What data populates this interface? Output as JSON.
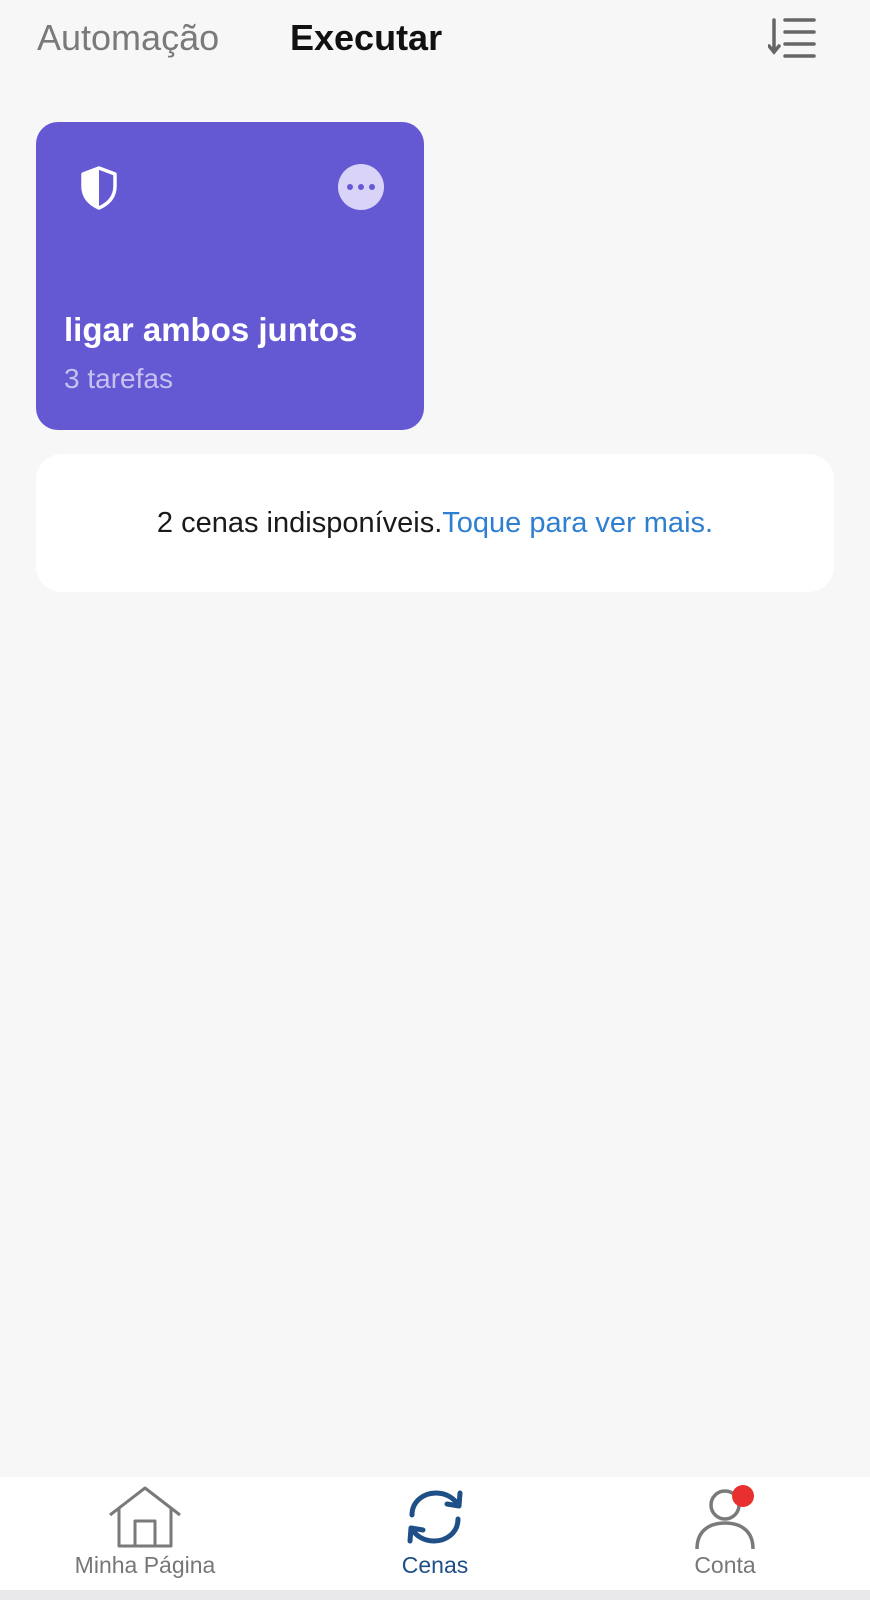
{
  "header": {
    "tabs": [
      {
        "label": "Automação",
        "active": false
      },
      {
        "label": "Executar",
        "active": true
      }
    ],
    "sort_icon": "sort-list-icon"
  },
  "scene_card": {
    "title": "ligar ambos juntos",
    "subtitle": "3 tarefas",
    "icon": "shield-icon",
    "more_icon": "more-dots-icon",
    "color": "#6559d3"
  },
  "unavailable_notice": {
    "text": "2 cenas indisponíveis.",
    "link": "Toque para ver mais."
  },
  "bottom_nav": {
    "items": [
      {
        "label": "Minha Página",
        "icon": "home-icon",
        "active": false
      },
      {
        "label": "Cenas",
        "icon": "scenes-sync-icon",
        "active": true
      },
      {
        "label": "Conta",
        "icon": "account-icon",
        "active": false,
        "badge": true
      }
    ],
    "active_color": "#1e4f86",
    "badge_color": "#e8312f"
  }
}
